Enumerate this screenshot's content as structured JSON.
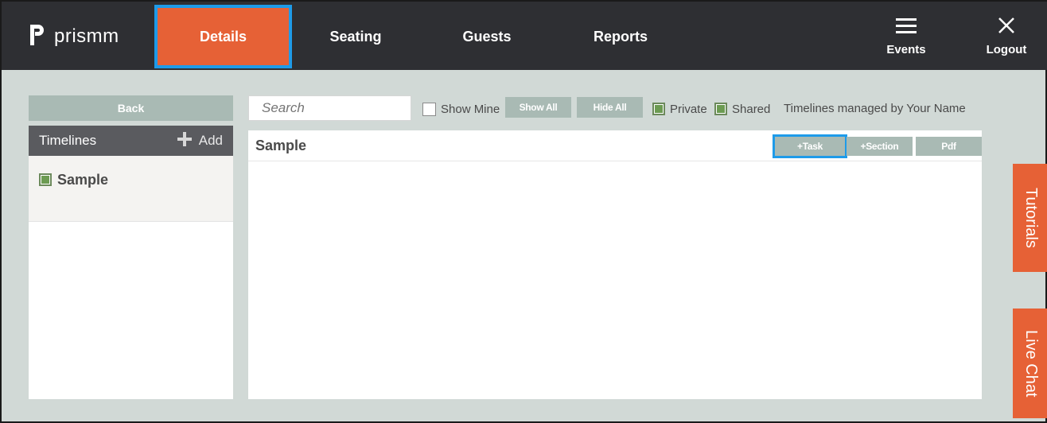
{
  "brand": {
    "name": "prismm"
  },
  "nav": {
    "tabs": [
      {
        "label": "Details",
        "active": true
      },
      {
        "label": "Seating",
        "active": false
      },
      {
        "label": "Guests",
        "active": false
      },
      {
        "label": "Reports",
        "active": false
      }
    ],
    "events_label": "Events",
    "logout_label": "Logout"
  },
  "left": {
    "back_label": "Back",
    "header_title": "Timelines",
    "add_label": "Add",
    "items": [
      {
        "label": "Sample",
        "checked": true
      }
    ]
  },
  "toolbar": {
    "search_placeholder": "Search",
    "show_mine_label": "Show Mine",
    "show_mine_checked": false,
    "show_all_label": "Show All",
    "hide_all_label": "Hide All",
    "private_label": "Private",
    "private_checked": true,
    "shared_label": "Shared",
    "shared_checked": true,
    "managed_by_prefix": "Timelines managed by",
    "managed_by_name": "Your Name"
  },
  "main": {
    "title": "Sample",
    "add_task_label": "+Task",
    "add_section_label": "+Section",
    "pdf_label": "Pdf"
  },
  "side_tabs": {
    "tutorials": "Tutorials",
    "live_chat": "Live Chat"
  },
  "colors": {
    "nav_bg": "#2e2f33",
    "accent_orange": "#e66136",
    "focus_blue": "#1e9be9",
    "button_sage": "#a9bab4",
    "page_bg": "#d1d9d6",
    "checkbox_green": "#6c9b52"
  }
}
